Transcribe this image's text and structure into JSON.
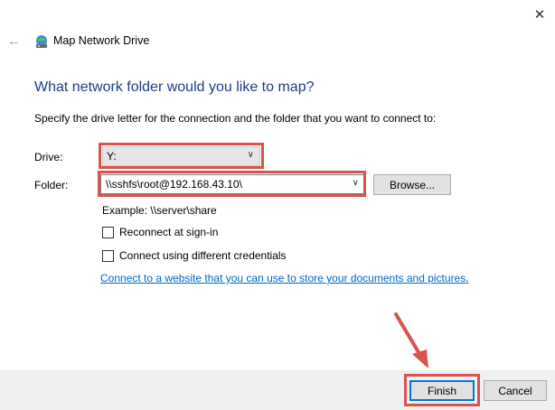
{
  "window": {
    "title": "Map Network Drive",
    "close_icon": "close-icon",
    "back_icon": "back-arrow-icon",
    "app_icon": "network-drive-icon"
  },
  "content": {
    "heading": "What network folder would you like to map?",
    "instruction": "Specify the drive letter for the connection and the folder that you want to connect to:",
    "drive_label": "Drive:",
    "drive_value": "Y:",
    "folder_label": "Folder:",
    "folder_value": "\\\\sshfs\\root@192.168.43.10\\",
    "browse_label": "Browse...",
    "example": "Example: \\\\server\\share",
    "reconnect_label": "Reconnect at sign-in",
    "credentials_label": "Connect using different credentials",
    "link_text": "Connect to a website that you can use to store your documents and pictures",
    "link_suffix": "."
  },
  "footer": {
    "finish_label": "Finish",
    "cancel_label": "Cancel"
  },
  "annotations": {
    "highlight_color": "#d9534f",
    "accent_color": "#1f3c88"
  }
}
